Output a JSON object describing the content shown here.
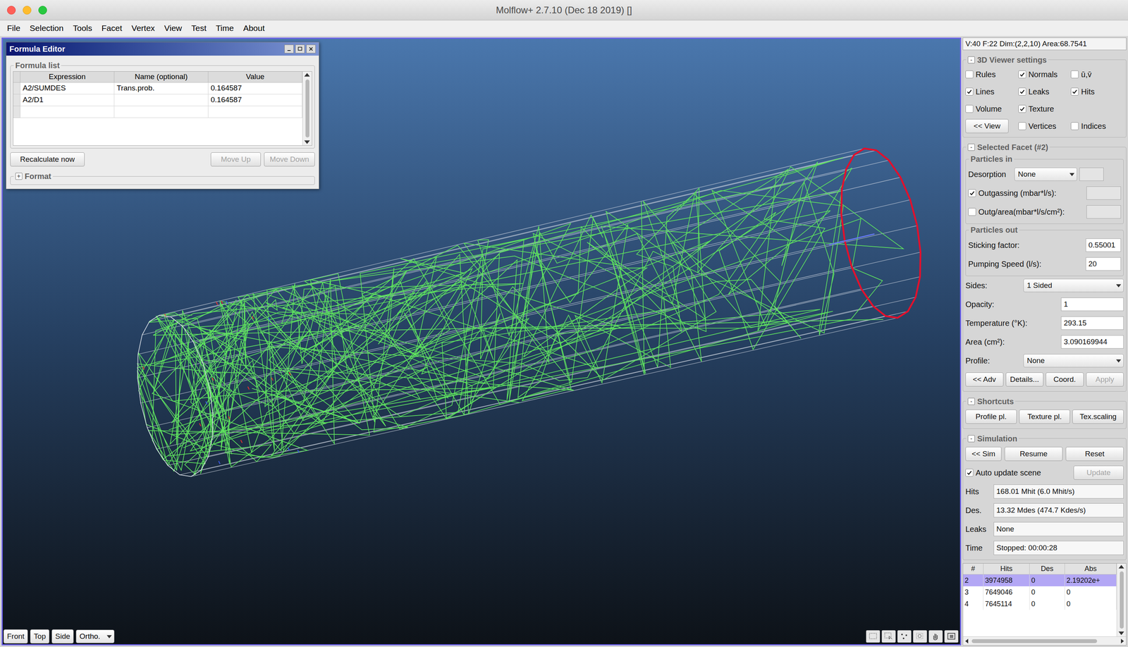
{
  "window": {
    "title": "Molflow+ 2.7.10 (Dec 18 2019) []"
  },
  "menu": [
    "File",
    "Selection",
    "Tools",
    "Facet",
    "Vertex",
    "View",
    "Test",
    "Time",
    "About"
  ],
  "formula_editor": {
    "title": "Formula Editor",
    "group": "Formula list",
    "columns": [
      "Expression",
      "Name (optional)",
      "Value"
    ],
    "rows": [
      [
        "A2/SUMDES",
        "Trans.prob.",
        "0.164587"
      ],
      [
        "A2/D1",
        "",
        "0.164587"
      ],
      [
        "",
        "",
        ""
      ]
    ],
    "buttons": [
      {
        "label": "Recalculate now",
        "disabled": false
      },
      {
        "label": "Move Up",
        "disabled": true
      },
      {
        "label": "Move Down",
        "disabled": true
      }
    ],
    "format": {
      "toggle": "+",
      "title": "Format",
      "expanded": false
    }
  },
  "viewer": {
    "view_buttons": [
      "Front",
      "Top",
      "Side"
    ],
    "projection": "Ortho."
  },
  "panel": {
    "status": "V:40 F:22 Dim:(2,2,10) Area:68.7541",
    "viewer_settings": {
      "toggle": "-",
      "title": "3D Viewer settings",
      "expanded": true,
      "rows": [
        [
          {
            "kind": "checkbox",
            "label": "Rules",
            "checked": false
          },
          {
            "kind": "checkbox",
            "label": "Normals",
            "checked": true
          },
          {
            "kind": "checkbox",
            "label": "ū,v̄",
            "checked": false
          }
        ],
        [
          {
            "kind": "checkbox",
            "label": "Lines",
            "checked": true
          },
          {
            "kind": "checkbox",
            "label": "Leaks",
            "checked": true
          },
          {
            "kind": "checkbox",
            "label": "Hits",
            "checked": true
          }
        ],
        [
          {
            "kind": "checkbox",
            "label": "Volume",
            "checked": false
          },
          {
            "kind": "checkbox",
            "label": "Texture",
            "checked": true
          }
        ],
        [
          {
            "kind": "button",
            "label": "<< View"
          },
          {
            "kind": "checkbox",
            "label": "Vertices",
            "checked": false
          },
          {
            "kind": "checkbox",
            "label": "Indices",
            "checked": false
          }
        ]
      ]
    },
    "selected_facet": {
      "toggle": "-",
      "title": "Selected Facet (#2)",
      "expanded": true,
      "particles_in": {
        "title": "Particles in",
        "desorption": {
          "label": "Desorption",
          "value": "None"
        },
        "outgassing": {
          "label": "Outgassing (mbar*l/s):",
          "checked": true,
          "value": "",
          "disabled": true
        },
        "outg_area": {
          "label": "Outg/area(mbar*l/s/cm²):",
          "checked": false,
          "value": "",
          "disabled": true
        }
      },
      "particles_out": {
        "title": "Particles out",
        "rows": [
          {
            "label": "Sticking factor:",
            "value": "0.55001"
          },
          {
            "label": "Pumping Speed (l/s):",
            "value": "20"
          }
        ]
      },
      "fields": [
        {
          "label": "Sides:",
          "value": "1 Sided",
          "kind": "dropdown"
        },
        {
          "label": "Opacity:",
          "value": "1",
          "kind": "text"
        },
        {
          "label": "Temperature (°K):",
          "value": "293.15",
          "kind": "text"
        },
        {
          "label": "Area (cm²):",
          "value": "3.090169944",
          "kind": "text"
        },
        {
          "label": "Profile:",
          "value": "None",
          "kind": "dropdown"
        }
      ],
      "buttons": [
        {
          "label": "<< Adv",
          "disabled": false
        },
        {
          "label": "Details...",
          "disabled": false
        },
        {
          "label": "Coord.",
          "disabled": false
        },
        {
          "label": "Apply",
          "disabled": true
        }
      ]
    },
    "shortcuts": {
      "toggle": "-",
      "title": "Shortcuts",
      "expanded": true,
      "buttons": [
        "Profile pl.",
        "Texture pl.",
        "Tex.scaling"
      ]
    },
    "simulation": {
      "toggle": "-",
      "title": "Simulation",
      "expanded": true,
      "buttons": [
        "<< Sim",
        "Resume",
        "Reset"
      ],
      "auto_update": {
        "label": "Auto update scene",
        "checked": true
      },
      "update": {
        "label": "Update",
        "disabled": true
      },
      "stats": [
        {
          "label": "Hits",
          "value": "168.01 Mhit (6.0 Mhit/s)"
        },
        {
          "label": "Des.",
          "value": "13.32 Mdes (474.7 Kdes/s)"
        },
        {
          "label": "Leaks",
          "value": "None"
        },
        {
          "label": "Time",
          "value": "Stopped: 00:00:28"
        }
      ]
    },
    "facet_table": {
      "columns": [
        "#",
        "Hits",
        "Des",
        "Abs"
      ],
      "rows": [
        {
          "cells": [
            "2",
            "3974958",
            "0",
            "2.19202e+"
          ],
          "selected": true
        },
        {
          "cells": [
            "3",
            "7649046",
            "0",
            "0"
          ],
          "selected": false
        },
        {
          "cells": [
            "4",
            "7645114",
            "0",
            "0"
          ],
          "selected": false
        }
      ]
    }
  }
}
